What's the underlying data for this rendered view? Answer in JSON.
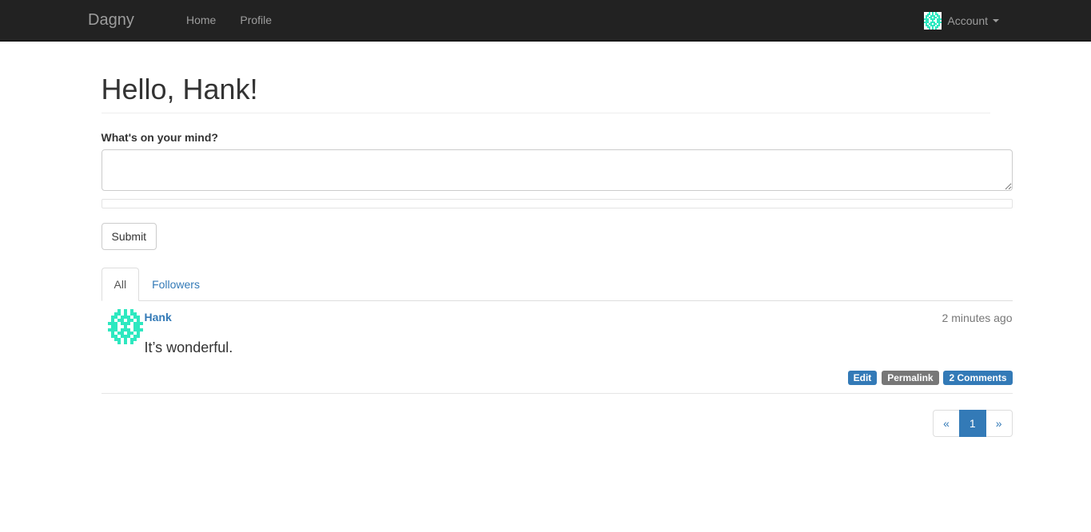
{
  "navbar": {
    "brand": "Dagny",
    "links": [
      {
        "label": "Home"
      },
      {
        "label": "Profile"
      }
    ],
    "account": {
      "label": "Account",
      "avatar_icon": "identicon-avatar",
      "caret_icon": "caret-down-icon"
    },
    "background_color": "#222222",
    "text_color": "#9d9d9d"
  },
  "page": {
    "heading": "Hello, Hank!"
  },
  "post_form": {
    "label": "What's on your mind?",
    "textarea_value": "",
    "textarea_placeholder": "",
    "progress_percent": 0,
    "submit_label": "Submit"
  },
  "tabs": [
    {
      "label": "All",
      "active": true
    },
    {
      "label": "Followers",
      "active": false
    }
  ],
  "feed": {
    "posts": [
      {
        "author": "Hank",
        "avatar_icon": "identicon-avatar",
        "content": "It’s wonderful.",
        "timestamp": "2 minutes ago",
        "actions": [
          {
            "label": "Edit",
            "style": "primary"
          },
          {
            "label": "Permalink",
            "style": "default"
          },
          {
            "label": "2 Comments",
            "style": "primary"
          }
        ]
      }
    ]
  },
  "pagination": {
    "prev_label": "«",
    "next_label": "»",
    "pages": [
      {
        "label": "1",
        "active": true
      }
    ]
  },
  "colors": {
    "link": "#337ab7",
    "navbar_bg": "#222222",
    "badge_default": "#777777",
    "avatar_accent": "#2EE8C0",
    "muted_text": "#777777"
  }
}
